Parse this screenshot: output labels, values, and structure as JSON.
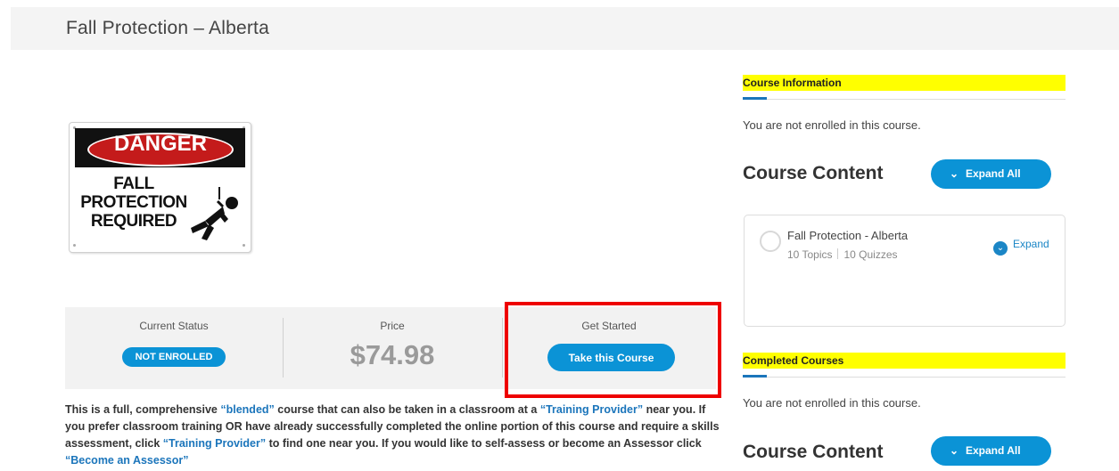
{
  "page": {
    "title": "Fall Protection – Alberta"
  },
  "sign": {
    "danger": "DANGER",
    "line1": "FALL",
    "line2": "PROTECTION",
    "line3": "REQUIRED"
  },
  "status": {
    "current_status_label": "Current Status",
    "current_status_value": "NOT ENROLLED",
    "price_label": "Price",
    "price_value": "$74.98",
    "get_started_label": "Get Started",
    "take_course": "Take this Course"
  },
  "description": {
    "t1": "This is a full, comprehensive ",
    "l1": "“blended”",
    "t2": " course that can also be taken in a classroom at a ",
    "l2": "“Training Provider”",
    "t3": " near you. If you prefer classroom training OR have already successfully completed the online portion of this course and require a skills assessment, click ",
    "l3": "“Training Provider”",
    "t4": " to find one near you. If you would like to self-assess or become an Assessor click ",
    "l4": "“Become an Assessor”"
  },
  "sidebar": {
    "course_info_heading": "Course Information",
    "course_info_note": "You are not enrolled in this course.",
    "course_content_heading": "Course Content",
    "expand_all": "Expand All",
    "lesson": {
      "name": "Fall Protection - Alberta",
      "topics": "10 Topics",
      "quizzes": "10 Quizzes",
      "expand": "Expand"
    },
    "completed_heading": "Completed Courses",
    "completed_note": "You are not enrolled in this course.",
    "course_content_heading_2": "Course Content",
    "expand_all_2": "Expand All"
  },
  "colors": {
    "accent": "#0b93d6",
    "highlight": "#ffff00",
    "annotation": "#ee0000",
    "link": "#1b75bb"
  },
  "icons": [
    "chevron-down-icon",
    "expand-circle-icon",
    "progress-circle-icon",
    "worker-falling-icon"
  ]
}
